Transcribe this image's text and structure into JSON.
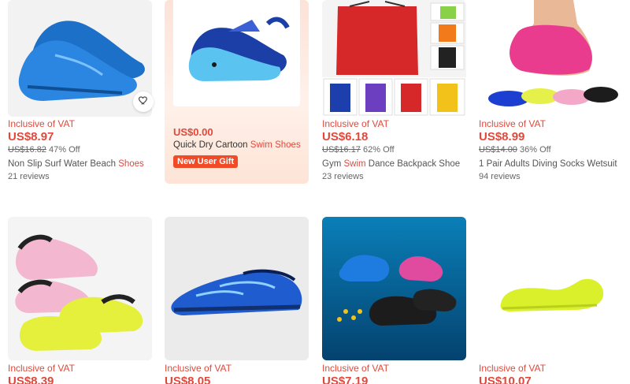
{
  "products": [
    {
      "vat": "Inclusive of VAT",
      "price": "US$8.97",
      "original_price": "US$16.82",
      "discount": "47% Off",
      "title_pre": "Non Slip Surf Water Beach ",
      "title_hl": "Shoes",
      "reviews": "21 reviews"
    },
    {
      "vat": "Inclusive of VAT",
      "price": "US$6.18",
      "original_price": "US$16.17",
      "discount": "62% Off",
      "title_pre": "Gym ",
      "title_hl": "Swim",
      "title_post": " Dance Backpack Shoe",
      "reviews": "23 reviews"
    },
    {
      "vat": "Inclusive of VAT",
      "price": "US$8.99",
      "original_price": "US$14.00",
      "discount": "36% Off",
      "title_pre": "1 Pair Adults Diving Socks Wetsuit",
      "reviews": "94 reviews"
    },
    {
      "vat": "Inclusive of VAT",
      "price": "US$8.39"
    },
    {
      "vat": "Inclusive of VAT",
      "price": "US$8.05"
    },
    {
      "vat": "Inclusive of VAT",
      "price": "US$7.19"
    },
    {
      "vat": "Inclusive of VAT",
      "price": "US$10.07"
    }
  ],
  "promo": {
    "price": "US$0.00",
    "title_pre": "Quick Dry Cartoon ",
    "title_hl": "Swim Shoes",
    "badge": "New User Gift"
  },
  "icons": {
    "wishlist": "heart-outline-icon"
  },
  "colors": {
    "accent": "#e1483b",
    "badge": "#f04a27"
  }
}
